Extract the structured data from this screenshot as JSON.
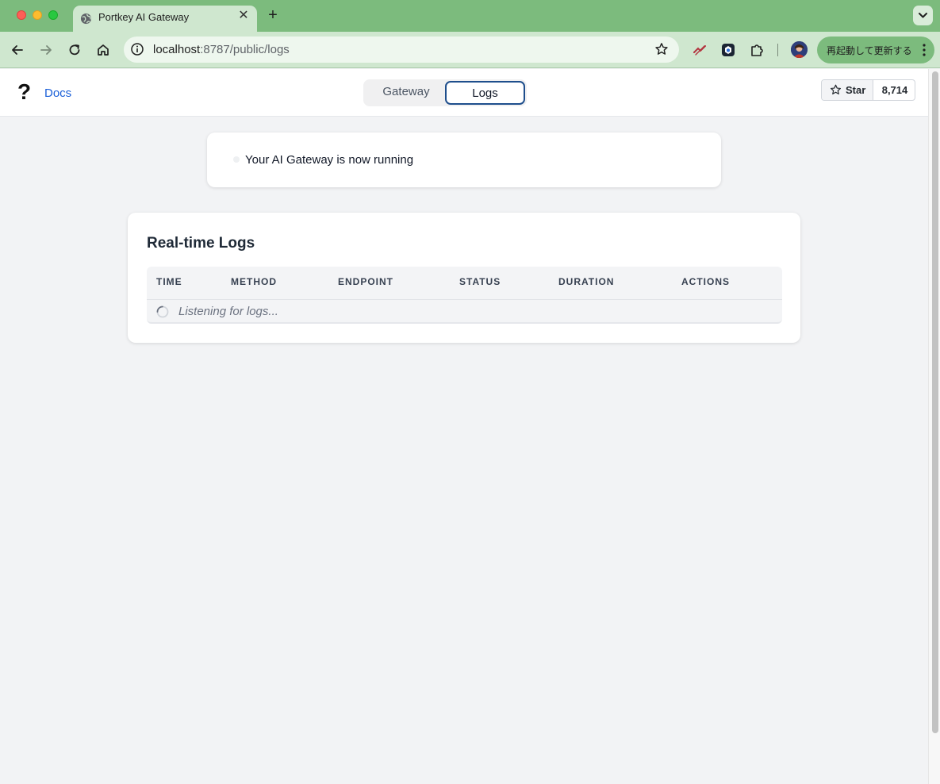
{
  "browser": {
    "tab": {
      "title": "Portkey AI Gateway"
    },
    "address": {
      "host": "localhost",
      "path": ":8787/public/logs"
    },
    "update_button": {
      "label": "再起動して更新する"
    }
  },
  "header": {
    "help_icon": "?",
    "docs_link": "Docs",
    "segments": {
      "gateway": "Gateway",
      "logs": "Logs",
      "active": "logs"
    },
    "github": {
      "star_label": "Star",
      "star_count": "8,714"
    }
  },
  "status": {
    "text": "Your AI Gateway is now running"
  },
  "logs": {
    "title": "Real-time Logs",
    "columns": [
      "TIME",
      "METHOD",
      "ENDPOINT",
      "STATUS",
      "DURATION",
      "ACTIONS"
    ],
    "empty_message": "Listening for logs..."
  },
  "colors": {
    "browser_frame": "#7cbb7d",
    "toolbar": "#cfe7cf",
    "page_background": "#f2f3f5",
    "link": "#1a5fd8",
    "active_segment_border": "#1e4e8c"
  }
}
